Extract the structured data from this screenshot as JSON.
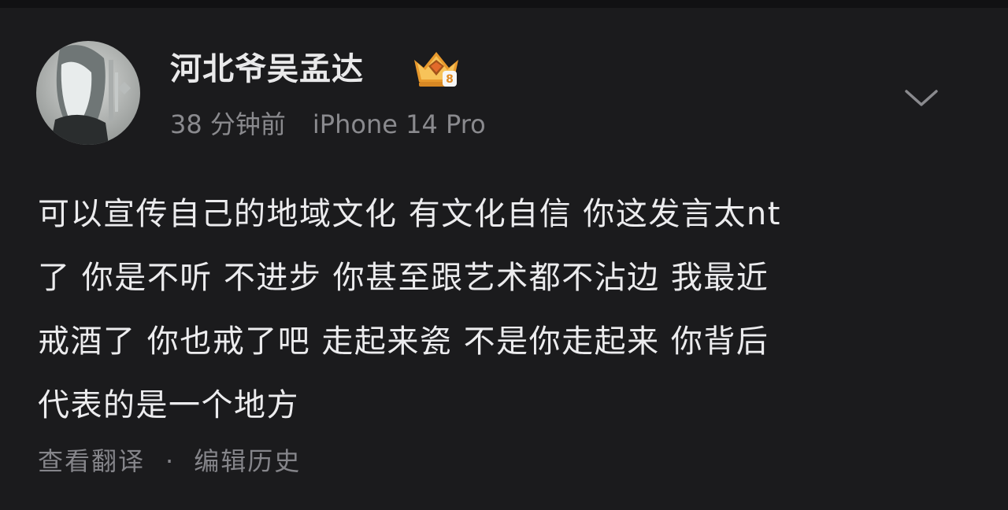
{
  "post": {
    "author": {
      "name": "河北爷吴孟达",
      "badge_icon": "vip-crown-badge-icon",
      "avatar_icon": "user-avatar"
    },
    "meta": {
      "time": "38 分钟前",
      "device": "iPhone 14 Pro"
    },
    "more_icon": "chevron-down-icon",
    "content": {
      "lines": [
        "可以宣传自己的地域文化 有文化自信 你这发言太nt",
        "了 你是不听 不进步 你甚至跟艺术都不沾边 我最近",
        "戒酒了 你也戒了吧 走起来瓷 不是你走起来 你背后",
        "代表的是一个地方"
      ]
    },
    "actions": {
      "translate_label": "查看翻译",
      "separator": "·",
      "history_label": "编辑历史"
    }
  },
  "colors": {
    "background": "#1b1b1d",
    "primary_text": "#ececee",
    "secondary_text": "#8a8a8e",
    "badge_gold": "#f2b441"
  }
}
